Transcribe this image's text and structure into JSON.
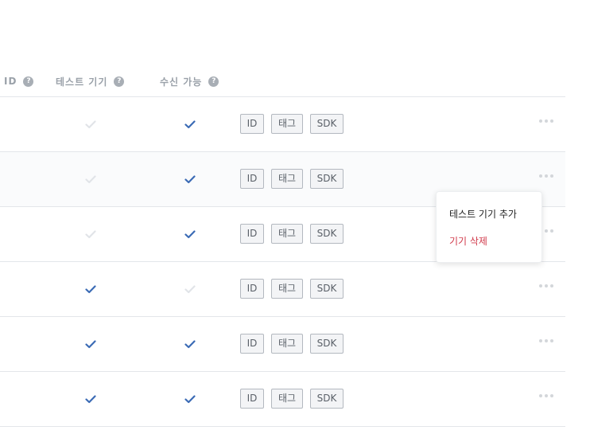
{
  "header": {
    "col_id": "ID",
    "col_test_device": "테스트 기기",
    "col_receivable": "수신 가능",
    "help_glyph": "?"
  },
  "rows": [
    {
      "test_device": false,
      "receivable": true,
      "tags": [
        "ID",
        "태그",
        "SDK"
      ]
    },
    {
      "test_device": false,
      "receivable": true,
      "tags": [
        "ID",
        "태그",
        "SDK"
      ]
    },
    {
      "test_device": false,
      "receivable": true,
      "tags": [
        "ID",
        "태그",
        "SDK"
      ]
    },
    {
      "test_device": true,
      "receivable": false,
      "tags": [
        "ID",
        "태그",
        "SDK"
      ]
    },
    {
      "test_device": true,
      "receivable": true,
      "tags": [
        "ID",
        "태그",
        "SDK"
      ]
    },
    {
      "test_device": true,
      "receivable": true,
      "tags": [
        "ID",
        "태그",
        "SDK"
      ]
    }
  ],
  "context_menu": {
    "add_test_device": "테스트 기기 추가",
    "delete_device": "기기 삭제"
  },
  "colors": {
    "check_on": "#3b6bb5",
    "check_off": "#e1e4e8",
    "danger": "#d0394a"
  },
  "icons": {
    "check": "check-icon",
    "help": "help-icon",
    "more": "more-options-icon"
  }
}
